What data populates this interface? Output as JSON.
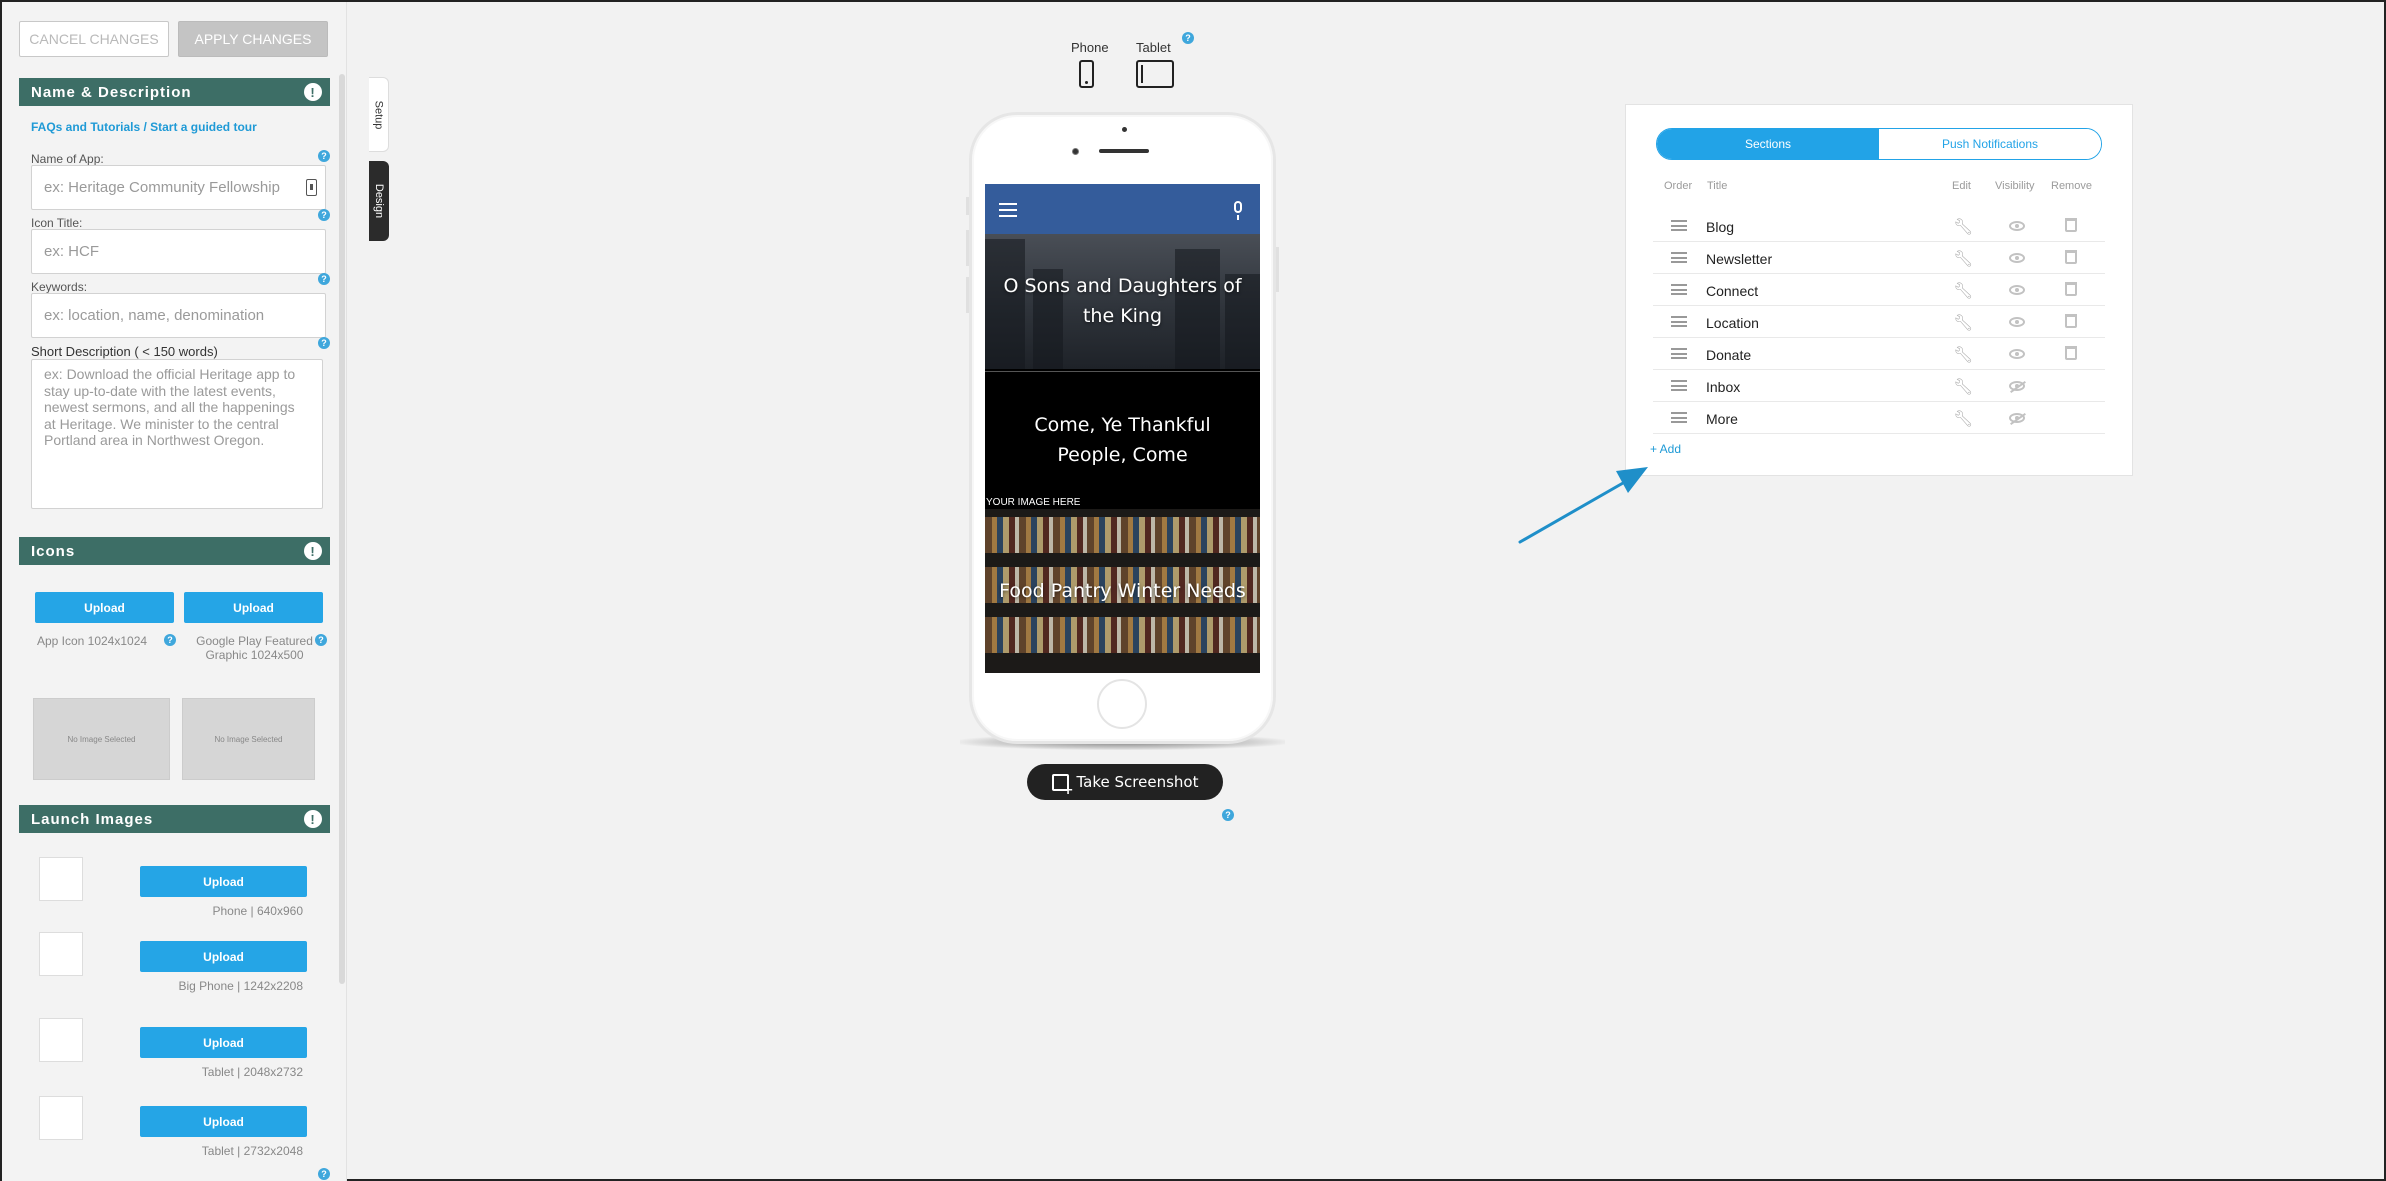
{
  "toolbar": {
    "cancel_label": "CANCEL CHANGES",
    "apply_label": "APPLY CHANGES"
  },
  "name_section": {
    "heading": "Name & Description",
    "help_link": "FAQs and Tutorials / Start a guided tour",
    "app_name_label": "Name of App:",
    "app_name_placeholder": "ex: Heritage Community Fellowship",
    "icon_title_label": "Icon Title:",
    "icon_title_placeholder": "ex: HCF",
    "keywords_label": "Keywords:",
    "keywords_placeholder": "ex: location, name, denomination",
    "short_desc_label": "Short Description ( < 150 words)",
    "short_desc_placeholder": "ex: Download the official Heritage app to stay up-to-date with the latest events, newest sermons, and all the happenings at Heritage. We minister to the central Portland area in Northwest Oregon."
  },
  "icons_section": {
    "heading": "Icons",
    "upload_label": "Upload",
    "app_icon_label": "App Icon 1024x1024",
    "featured_label": "Google Play Featured Graphic 1024x500",
    "no_image": "No Image Selected"
  },
  "launch_section": {
    "heading": "Launch Images",
    "upload_label": "Upload",
    "items": [
      {
        "label": "Phone | 640x960"
      },
      {
        "label": "Big Phone | 1242x2208"
      },
      {
        "label": "Tablet | 2048x2732"
      },
      {
        "label": "Tablet | 2732x2048"
      }
    ]
  },
  "side_tabs": {
    "setup": "Setup",
    "design": "Design"
  },
  "device": {
    "phone_label": "Phone",
    "tablet_label": "Tablet",
    "selected": "Phone"
  },
  "preview": {
    "tiles": [
      {
        "text": "O Sons and Daughters of the King"
      },
      {
        "text": "Come, Ye Thankful People, Come"
      },
      {
        "text": "Food Pantry Winter Needs"
      }
    ],
    "image_placeholder": "YOUR IMAGE HERE"
  },
  "screenshot_label": "Take Screenshot",
  "sections_panel": {
    "tabs": [
      "Sections",
      "Push Notifications"
    ],
    "active_tab": "Sections",
    "columns": {
      "order": "Order",
      "title": "Title",
      "edit": "Edit",
      "visibility": "Visibility",
      "remove": "Remove"
    },
    "rows": [
      {
        "title": "Blog",
        "visible": true,
        "removable": true
      },
      {
        "title": "Newsletter",
        "visible": true,
        "removable": true
      },
      {
        "title": "Connect",
        "visible": true,
        "removable": true
      },
      {
        "title": "Location",
        "visible": true,
        "removable": true
      },
      {
        "title": "Donate",
        "visible": true,
        "removable": true
      },
      {
        "title": "Inbox",
        "visible": false,
        "removable": false
      },
      {
        "title": "More",
        "visible": false,
        "removable": false
      }
    ],
    "add_label": "+ Add"
  },
  "colors": {
    "accent": "#22a3e7",
    "section_header": "#3d6e66",
    "app_bar": "#345c9b",
    "arrow": "#1f8fc9"
  }
}
